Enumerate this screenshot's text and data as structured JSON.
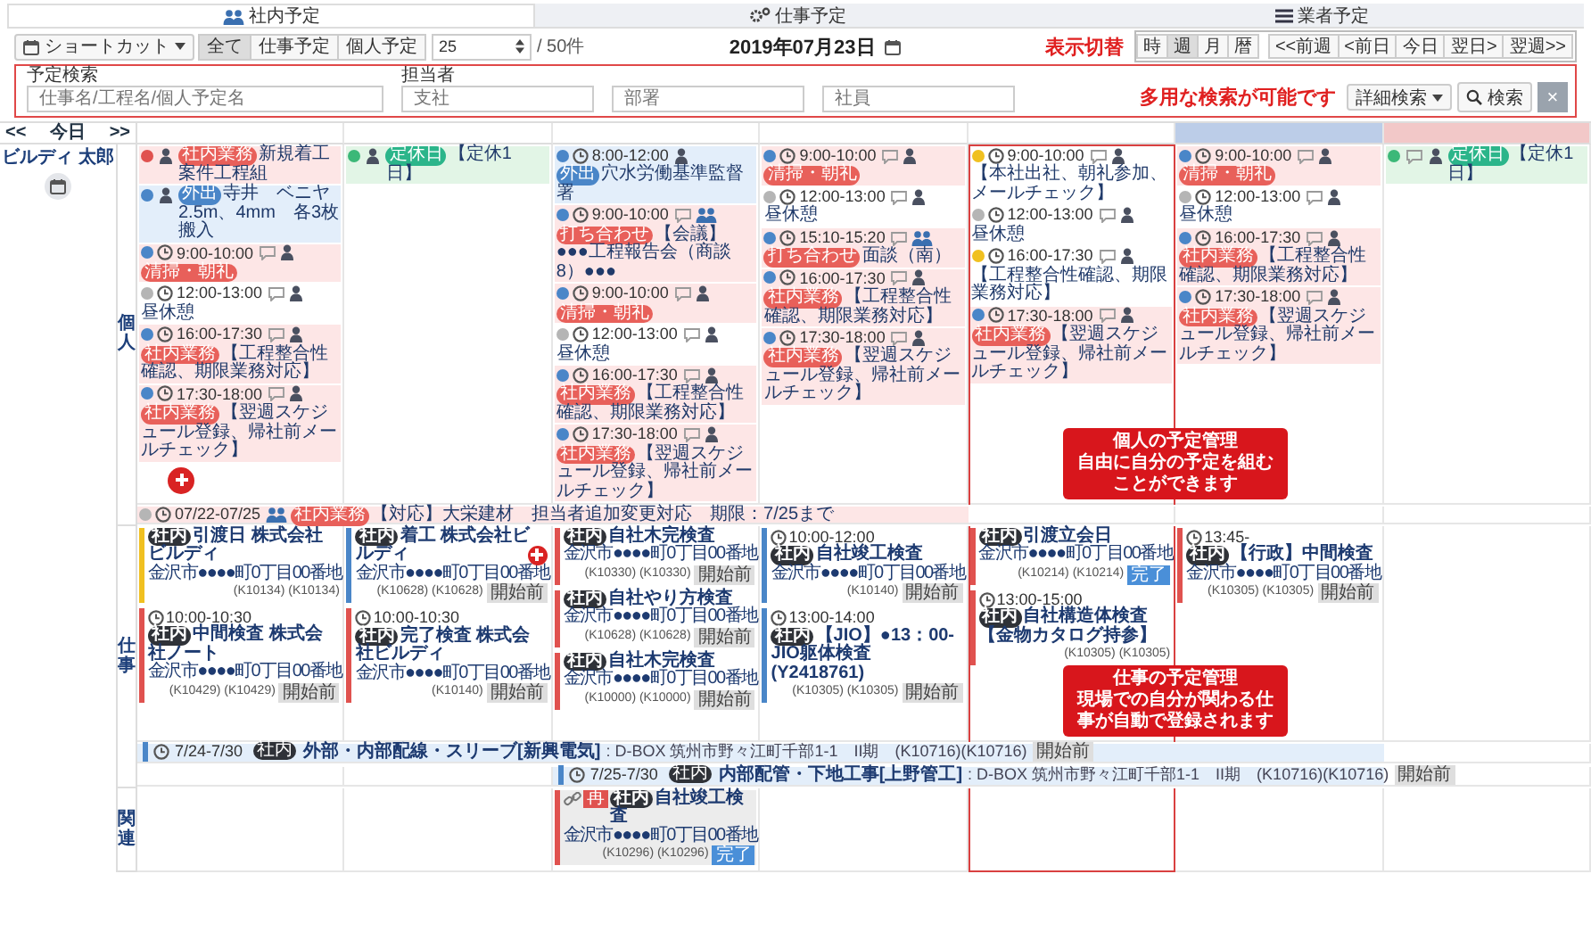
{
  "tabs": [
    {
      "label": "社内予定",
      "selected": true
    },
    {
      "label": "仕事予定",
      "selected": false
    },
    {
      "label": "業者予定",
      "selected": false
    }
  ],
  "toolbar": {
    "shortcut": "ショートカット",
    "filters": [
      {
        "label": "全て",
        "selected": true
      },
      {
        "label": "仕事予定",
        "selected": false
      },
      {
        "label": "個人予定",
        "selected": false
      }
    ],
    "page_size": "25",
    "page_total": "/ 50件",
    "date": "2019年07月23日",
    "view_label": "表示切替",
    "views": [
      {
        "label": "時",
        "selected": false
      },
      {
        "label": "週",
        "selected": true
      },
      {
        "label": "月",
        "selected": false
      },
      {
        "label": "暦",
        "selected": false
      }
    ],
    "nav": [
      "<<前週",
      "<前日",
      "今日",
      "翌日>",
      "翌週>>"
    ]
  },
  "search": {
    "fields": [
      {
        "label": "予定検索",
        "placeholder": "仕事名/工程名/個人予定名"
      },
      {
        "label": "担当者",
        "placeholder": "支社"
      },
      {
        "placeholder": "部署"
      },
      {
        "placeholder": "社員"
      }
    ],
    "hint": "多用な検索が可能です",
    "detail": "詳細検索",
    "submit": "検索",
    "clear": "×"
  },
  "calendar": {
    "nav": [
      "<<",
      "今日",
      ">>"
    ],
    "person": "ビルディ 太郎",
    "days": [
      {
        "kind": "weekday",
        "highlighted": false
      },
      {
        "kind": "weekday",
        "highlighted": false
      },
      {
        "kind": "weekday",
        "highlighted": false
      },
      {
        "kind": "weekday",
        "highlighted": false
      },
      {
        "kind": "weekday",
        "highlighted": true
      },
      {
        "kind": "saturday",
        "highlighted": false
      },
      {
        "kind": "sunday",
        "highlighted": false
      }
    ],
    "sections": [
      {
        "label": "個人",
        "kind": "personal",
        "note": [
          "個人の予定管理",
          "自由に自分の予定を組む",
          "ことができます"
        ],
        "days": [
          {
            "add": true,
            "entries": [
              {
                "color": "#e0524f",
                "comment": false,
                "group": false,
                "tag": {
                  "label": "社内業務",
                  "color": "#e8605a"
                },
                "text": "新規着工案件工程組",
                "kind": "task"
              },
              {
                "color": "#4a86c8",
                "comment": false,
                "group": false,
                "tag": {
                  "label": "外出",
                  "color": "#4a86c8"
                },
                "text": "寺井　ベニヤ2.5m、4mm　各3枚搬入",
                "kind": "outing"
              },
              {
                "color": "#4a86c8",
                "time": "9:00-10:00",
                "comment": true,
                "group": false,
                "tag": {
                  "label": "清掃・朝礼",
                  "color": "#e8605a"
                },
                "kind": "task"
              },
              {
                "color": "#b5b5b5",
                "time": "12:00-13:00",
                "comment": true,
                "group": false,
                "text": "昼休憩",
                "kind": "plain"
              },
              {
                "color": "#4a86c8",
                "time": "16:00-17:30",
                "comment": true,
                "group": false,
                "tag": {
                  "label": "社内業務",
                  "color": "#e8605a"
                },
                "text": "【工程整合性確認、期限業務対応】",
                "kind": "task"
              },
              {
                "color": "#4a86c8",
                "time": "17:30-18:00",
                "comment": true,
                "group": false,
                "tag": {
                  "label": "社内業務",
                  "color": "#e8605a"
                },
                "text": "【翌週スケジュール登録、帰社前メールチェック】",
                "kind": "task"
              }
            ]
          },
          {
            "add": false,
            "entries": [
              {
                "color": "#3cb878",
                "comment": false,
                "group": false,
                "tag": {
                  "label": "定休日",
                  "color": "#2bb58a"
                },
                "text": "【定休1日】",
                "kind": "holiday"
              }
            ]
          },
          {
            "add": false,
            "entries": [
              {
                "color": "#4a86c8",
                "time": "8:00-12:00",
                "comment": false,
                "group": false,
                "tag": {
                  "label": "外出",
                  "color": "#4a86c8"
                },
                "text": "穴水労働基準監督署",
                "kind": "outing"
              },
              {
                "color": "#4a86c8",
                "time": "9:00-10:00",
                "comment": true,
                "group": true,
                "tag": {
                  "label": "打ち合わせ",
                  "color": "#e8605a"
                },
                "text": "【会議】●●●工程報告会（商談8）●●●",
                "kind": "task"
              },
              {
                "color": "#4a86c8",
                "time": "9:00-10:00",
                "comment": true,
                "group": false,
                "tag": {
                  "label": "清掃・朝礼",
                  "color": "#e8605a"
                },
                "kind": "task"
              },
              {
                "color": "#b5b5b5",
                "time": "12:00-13:00",
                "comment": true,
                "group": false,
                "text": "昼休憩",
                "kind": "plain"
              },
              {
                "color": "#4a86c8",
                "time": "16:00-17:30",
                "comment": true,
                "group": false,
                "tag": {
                  "label": "社内業務",
                  "color": "#e8605a"
                },
                "text": "【工程整合性確認、期限業務対応】",
                "kind": "task"
              },
              {
                "color": "#4a86c8",
                "time": "17:30-18:00",
                "comment": true,
                "group": false,
                "tag": {
                  "label": "社内業務",
                  "color": "#e8605a"
                },
                "text": "【翌週スケジュール登録、帰社前メールチェック】",
                "kind": "task"
              }
            ]
          },
          {
            "add": false,
            "entries": [
              {
                "color": "#4a86c8",
                "time": "9:00-10:00",
                "comment": true,
                "group": false,
                "tag": {
                  "label": "清掃・朝礼",
                  "color": "#e8605a"
                },
                "kind": "task"
              },
              {
                "color": "#b5b5b5",
                "time": "12:00-13:00",
                "comment": true,
                "group": false,
                "text": "昼休憩",
                "kind": "plain"
              },
              {
                "color": "#4a86c8",
                "time": "15:10-15:20",
                "comment": true,
                "group": true,
                "tag": {
                  "label": "打ち合わせ",
                  "color": "#e8605a"
                },
                "text": "面談（南）",
                "kind": "task"
              },
              {
                "color": "#4a86c8",
                "time": "16:00-17:30",
                "comment": true,
                "group": false,
                "tag": {
                  "label": "社内業務",
                  "color": "#e8605a"
                },
                "text": "【工程整合性確認、期限業務対応】",
                "kind": "task"
              },
              {
                "color": "#4a86c8",
                "time": "17:30-18:00",
                "comment": true,
                "group": false,
                "tag": {
                  "label": "社内業務",
                  "color": "#e8605a"
                },
                "text": "【翌週スケジュール登録、帰社前メールチェック】",
                "kind": "task"
              }
            ]
          },
          {
            "add": false,
            "entries": [
              {
                "color": "#f0c020",
                "time": "9:00-10:00",
                "comment": true,
                "group": false,
                "text": "【本社出社、朝礼参加、メールチェック】",
                "kind": "plain"
              },
              {
                "color": "#b5b5b5",
                "time": "12:00-13:00",
                "comment": true,
                "group": false,
                "text": "昼休憩",
                "kind": "plain"
              },
              {
                "color": "#f0c020",
                "time": "16:00-17:30",
                "comment": true,
                "group": false,
                "text": "【工程整合性確認、期限業務対応】",
                "kind": "plain"
              },
              {
                "color": "#4a86c8",
                "time": "17:30-18:00",
                "comment": true,
                "group": false,
                "tag": {
                  "label": "社内業務",
                  "color": "#e8605a"
                },
                "text": "【翌週スケジュール登録、帰社前メールチェック】",
                "kind": "task"
              }
            ]
          },
          {
            "add": false,
            "entries": [
              {
                "color": "#4a86c8",
                "time": "9:00-10:00",
                "comment": true,
                "group": false,
                "tag": {
                  "label": "清掃・朝礼",
                  "color": "#e8605a"
                },
                "kind": "task"
              },
              {
                "color": "#b5b5b5",
                "time": "12:00-13:00",
                "comment": true,
                "group": false,
                "text": "昼休憩",
                "kind": "plain"
              },
              {
                "color": "#4a86c8",
                "time": "16:00-17:30",
                "comment": true,
                "group": false,
                "tag": {
                  "label": "社内業務",
                  "color": "#e8605a"
                },
                "text": "【工程整合性確認、期限業務対応】",
                "kind": "task"
              },
              {
                "color": "#4a86c8",
                "time": "17:30-18:00",
                "comment": true,
                "group": false,
                "tag": {
                  "label": "社内業務",
                  "color": "#e8605a"
                },
                "text": "【翌週スケジュール登録、帰社前メールチェック】",
                "kind": "task"
              }
            ]
          },
          {
            "add": false,
            "entries": [
              {
                "color": "#3cb878",
                "comment": true,
                "group": false,
                "tag": {
                  "label": "定休日",
                  "color": "#2bb58a"
                },
                "text": "【定休1日】",
                "kind": "holiday"
              }
            ]
          }
        ],
        "spans": [
          {
            "covers": [
              true,
              true,
              true,
              true,
              false,
              false,
              false
            ],
            "color": "#b5b5b5",
            "time": "07/22-07/25",
            "comment": false,
            "group": true,
            "tag": {
              "label": "社内業務",
              "color": "#e8605a"
            },
            "text": "【対応】大栄建材　担当者追加変更対応　期限：7/25まで",
            "kind": "task"
          }
        ]
      },
      {
        "label": "仕事",
        "kind": "job",
        "note": [
          "仕事の予定管理",
          "現場での自分が関わる仕",
          "事が自動で登録されます"
        ],
        "days": [
          {
            "add": false,
            "entries": [
              {
                "color": "#f0c020",
                "tag": "社内",
                "title": "引渡日 株式会社ビルディ",
                "address": "金沢市●●●●町0丁目00番地",
                "codes": "(K10134) (K10134)",
                "kind": "site"
              },
              {
                "color": "#e0524f",
                "time": "10:00-10:30",
                "tag": "社内",
                "title": "中間検査 株式会社ノート",
                "address": "金沢市●●●●町0丁目00番地",
                "codes": "(K10429) (K10429)",
                "status": {
                  "label": "開始前",
                  "kind": "pending"
                },
                "kind": "site"
              }
            ]
          },
          {
            "add": true,
            "entries": [
              {
                "color": "#4a86c8",
                "tag": "社内",
                "title": "着工 株式会社ビルディ",
                "address": "金沢市●●●●町0丁目00番地",
                "codes": "(K10628) (K10628)",
                "status": {
                  "label": "開始前",
                  "kind": "pending"
                },
                "kind": "site"
              },
              {
                "color": "#e0524f",
                "time": "10:00-10:30",
                "tag": "社内",
                "title": "完了検査 株式会社ビルディ",
                "address": "金沢市●●●●町0丁目00番地",
                "codes": "(K10140)",
                "status": {
                  "label": "開始前",
                  "kind": "pending"
                },
                "kind": "site"
              }
            ]
          },
          {
            "add": false,
            "entries": [
              {
                "color": "#e0524f",
                "tag": "社内",
                "title": "自社木完検査",
                "address": "金沢市●●●●町0丁目00番地",
                "codes": "(K10330) (K10330)",
                "status": {
                  "label": "開始前",
                  "kind": "pending"
                },
                "kind": "site"
              },
              {
                "color": "#e0524f",
                "tag": "社内",
                "title": "自社やり方検査",
                "address": "金沢市●●●●町0丁目00番地",
                "codes": "(K10628) (K10628)",
                "status": {
                  "label": "開始前",
                  "kind": "pending"
                },
                "kind": "site"
              },
              {
                "color": "#e0524f",
                "tag": "社内",
                "title": "自社木完検査",
                "address": "金沢市●●●●町0丁目00番地",
                "codes": "(K10000) (K10000)",
                "status": {
                  "label": "開始前",
                  "kind": "pending"
                },
                "kind": "site"
              }
            ]
          },
          {
            "add": false,
            "entries": [
              {
                "color": "#4a86c8",
                "time": "10:00-12:00",
                "tag": "社内",
                "title": "自社竣工検査",
                "address": "金沢市●●●●町0丁目00番地",
                "codes": "(K10140)",
                "status": {
                  "label": "開始前",
                  "kind": "pending"
                },
                "kind": "site"
              },
              {
                "color": "#4a86c8",
                "time": "13:00-14:00",
                "tag": "社内",
                "title": "【JIO】●13：00-JIO躯体検査(Y2418761)",
                "codes": "(K10305) (K10305)",
                "status": {
                  "label": "開始前",
                  "kind": "pending"
                },
                "kind": "site"
              }
            ]
          },
          {
            "add": false,
            "entries": [
              {
                "color": "#e0524f",
                "tag": "社内",
                "title": "引渡立会日",
                "address": "金沢市●●●●町0丁目00番地",
                "codes": "(K10214) (K10214)",
                "status": {
                  "label": "完了",
                  "kind": "done"
                },
                "kind": "site"
              },
              {
                "color": "#e0524f",
                "time": "13:00-15:00",
                "tag": "社内",
                "title": "自社構造体検査【金物カタログ持参】",
                "codes": "(K10305) (K10305)",
                "kind": "site"
              }
            ]
          },
          {
            "add": false,
            "entries": [
              {
                "color": "#e0524f",
                "time": "13:45-",
                "tag": "社内",
                "title": "【行政】中間検査",
                "address": "金沢市●●●●町0丁目00番地",
                "codes": "(K10305) (K10305)",
                "status": {
                  "label": "開始前",
                  "kind": "pending"
                },
                "kind": "site"
              }
            ]
          },
          {
            "add": false
          }
        ],
        "spans": [
          {
            "covers": [
              true,
              true,
              true,
              true,
              true,
              true,
              false
            ],
            "color": "#4a86c8",
            "time": "7/24-7/30",
            "tag": "社内",
            "title": "外部・内部配線・スリーブ[新興電気]",
            "detail": ": D-BOX 筑州市野々江町千部1-1　II期　(K10716)(K10716)",
            "status": {
              "label": "開始前",
              "kind": "pending"
            },
            "kind": "site"
          },
          {
            "covers": [
              false,
              false,
              true,
              true,
              true,
              true,
              false
            ],
            "color": "#4a86c8",
            "time": "7/25-7/30",
            "tag": "社内",
            "title": "内部配管・下地工事[上野管工]",
            "detail": ": D-BOX 筑州市野々江町千部1-1　II期　(K10716)(K10716)",
            "status": {
              "label": "開始前",
              "kind": "pending"
            },
            "kind": "site"
          }
        ]
      },
      {
        "label": "関連",
        "kind": "job",
        "days": [
          {
            "add": false
          },
          {
            "add": false
          },
          {
            "add": false,
            "entries": [
              {
                "color": "#e0524f",
                "linked": true,
                "redo": "再",
                "tag": "社内",
                "title": "自社竣工検査",
                "address": "金沢市●●●●町0丁目00番地",
                "codes": "(K10296) (K10296)",
                "status": {
                  "label": "完了",
                  "kind": "done"
                },
                "kind": "related"
              }
            ]
          },
          {
            "add": false
          },
          {
            "add": false
          },
          {
            "add": false
          },
          {
            "add": false
          }
        ]
      }
    ]
  }
}
